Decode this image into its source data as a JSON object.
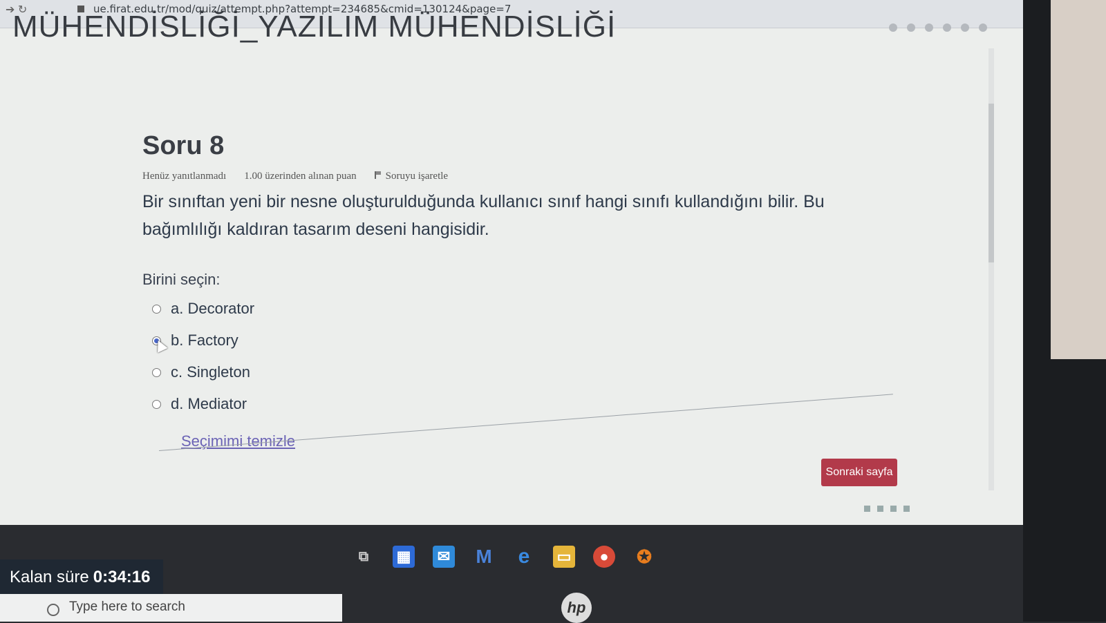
{
  "browser": {
    "url": "ue.firat.edu.tr/mod/quiz/attempt.php?attempt=234685&cmid=130124&page=7"
  },
  "course": {
    "header": "MÜHENDİSLİĞİ_YAZILIM MÜHENDİSLİĞİ"
  },
  "question": {
    "title": "Soru 8",
    "status": "Henüz yanıtlanmadı",
    "mark": "1.00 üzerinden alınan puan",
    "flag_label": "Soruyu işaretle",
    "text": "Bir sınıftan yeni bir nesne oluşturulduğunda kullanıcı sınıf hangi sınıfı kullandığını bilir. Bu bağımlılığı kaldıran tasarım deseni hangisidir.",
    "prompt": "Birini seçin:",
    "options": [
      {
        "label": "a. Decorator",
        "selected": false
      },
      {
        "label": "b. Factory",
        "selected": true
      },
      {
        "label": "c. Singleton",
        "selected": false
      },
      {
        "label": "d. Mediator",
        "selected": false
      }
    ],
    "clear_label": "Seçimimi temizle"
  },
  "navigation": {
    "next_label": "Sonraki sayfa"
  },
  "timer": {
    "label": "Kalan süre",
    "value": "0:34:16"
  },
  "taskbar": {
    "search_placeholder": "Type here to search",
    "apps": [
      "task-view-icon",
      "store-icon",
      "mail-icon",
      "m-app-icon",
      "edge-icon",
      "explorer-icon",
      "chrome-icon",
      "blender-icon"
    ],
    "colors": {
      "store": "#2d6ad6",
      "mail": "#2f8ad9",
      "m_app": "#3a6fc4",
      "edge": "#2d7cd6",
      "explorer": "#e5b53a",
      "chrome": "#d84a38",
      "blender": "#e87d1e"
    }
  },
  "colors": {
    "accent_link": "#6b63b5",
    "button": "#b23a4a",
    "radio_checked": "#4a67c8"
  }
}
